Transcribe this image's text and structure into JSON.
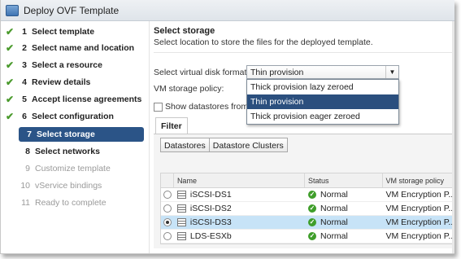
{
  "window": {
    "title": "Deploy OVF Template",
    "icon": "vm-template-icon"
  },
  "steps": [
    {
      "num": "1",
      "label": "Select template",
      "state": "done"
    },
    {
      "num": "2",
      "label": "Select name and location",
      "state": "done"
    },
    {
      "num": "3",
      "label": "Select a resource",
      "state": "done"
    },
    {
      "num": "4",
      "label": "Review details",
      "state": "done"
    },
    {
      "num": "5",
      "label": "Accept license agreements",
      "state": "done"
    },
    {
      "num": "6",
      "label": "Select configuration",
      "state": "done"
    },
    {
      "num": "7",
      "label": "Select storage",
      "state": "active"
    },
    {
      "num": "8",
      "label": "Select networks",
      "state": "next"
    },
    {
      "num": "9",
      "label": "Customize template",
      "state": "pending"
    },
    {
      "num": "10",
      "label": "vService bindings",
      "state": "pending"
    },
    {
      "num": "11",
      "label": "Ready to complete",
      "state": "pending"
    }
  ],
  "check_glyph": "✔",
  "main": {
    "title": "Select storage",
    "subtitle": "Select location to store the files for the deployed template.",
    "disk_format_label": "Select virtual disk format:",
    "disk_format_value": "Thin provision",
    "disk_format_options": [
      "Thick provision lazy zeroed",
      "Thin provision",
      "Thick provision eager zeroed"
    ],
    "policy_label": "VM storage policy:",
    "show_datastores_label": "Show datastores from"
  },
  "filter": {
    "tab_label": "Filter",
    "buttons": [
      "Datastores",
      "Datastore Clusters"
    ]
  },
  "grid": {
    "columns": [
      "Name",
      "Status",
      "VM storage policy"
    ],
    "rows": [
      {
        "name": "iSCSI-DS1",
        "status": "Normal",
        "policy": "VM Encryption P...",
        "selected": false
      },
      {
        "name": "iSCSI-DS2",
        "status": "Normal",
        "policy": "VM Encryption P...",
        "selected": false
      },
      {
        "name": "iSCSI-DS3",
        "status": "Normal",
        "policy": "VM Encryption P...",
        "selected": true
      },
      {
        "name": "LDS-ESXb",
        "status": "Normal",
        "policy": "VM Encryption P...",
        "selected": false
      }
    ]
  },
  "colors": {
    "accent": "#2b5487",
    "check": "#4a9a2c",
    "selected_row": "#c7e3f7",
    "status_ok": "#3f9e2a"
  }
}
